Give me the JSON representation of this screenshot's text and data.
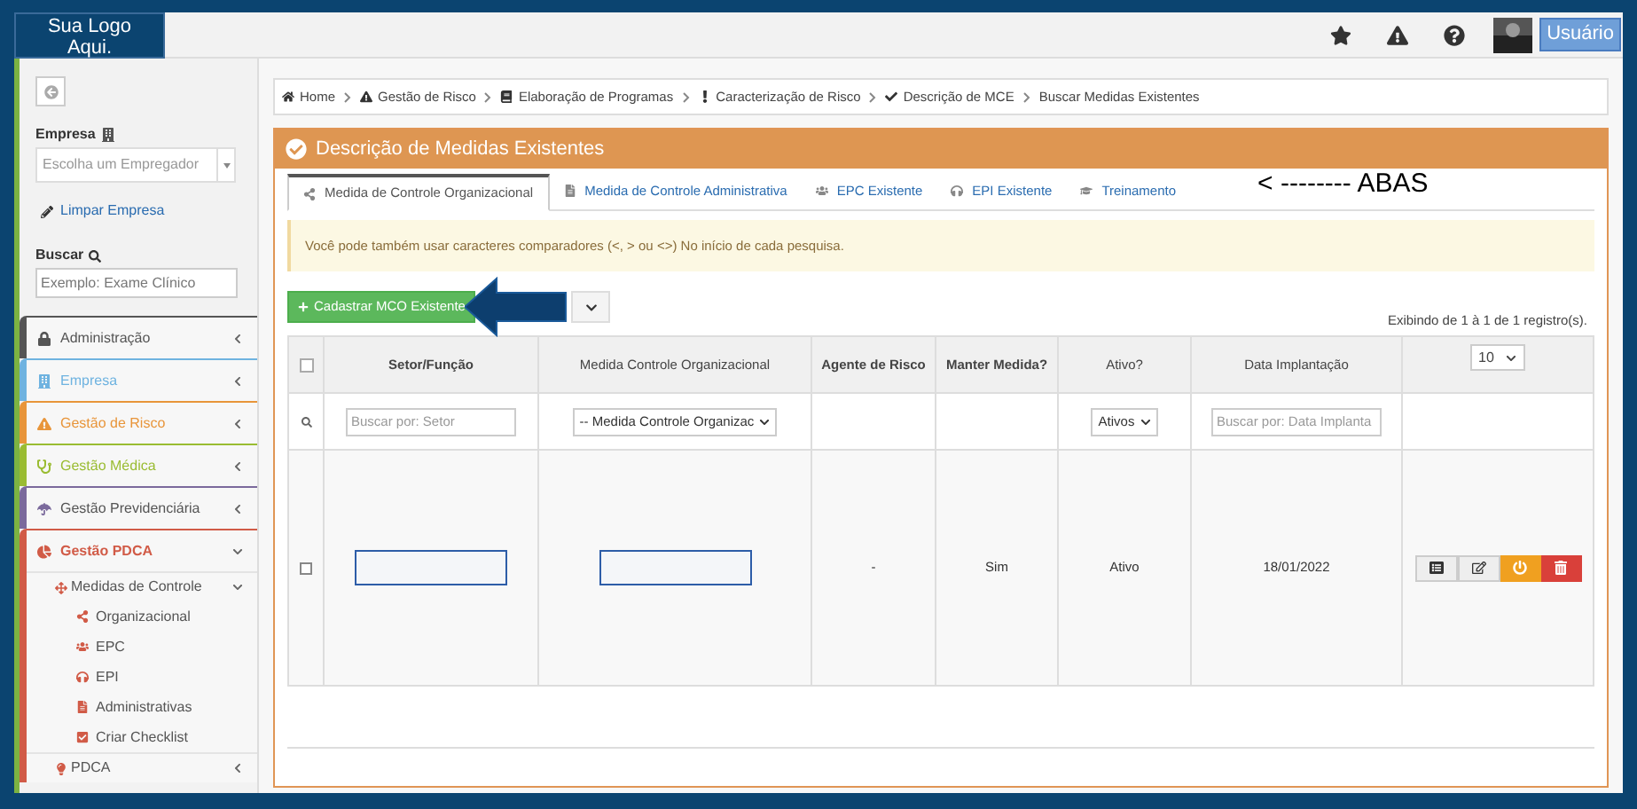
{
  "logo": {
    "text": "Sua Logo Aqui."
  },
  "topbar": {
    "user_button": "Usuário"
  },
  "sidebar": {
    "empresa_label": "Empresa",
    "empresa_select": {
      "placeholder": "Escolha um Empregador"
    },
    "clear_link": "Limpar Empresa",
    "search_label": "Buscar",
    "search": {
      "placeholder": "Exemplo: Exame Clínico"
    },
    "menu": [
      {
        "label": "Administração",
        "kind": "lock",
        "color": "#555555",
        "expanded": false
      },
      {
        "label": "Empresa",
        "kind": "building",
        "color": "#6fb3e0",
        "expanded": false
      },
      {
        "label": "Gestão de Risco",
        "kind": "warning",
        "color": "#e8953a",
        "expanded": false
      },
      {
        "label": "Gestão Médica",
        "kind": "stethoscope",
        "color": "#9abc32",
        "expanded": false
      },
      {
        "label": "Gestão Previdenciária",
        "kind": "umbrella",
        "color": "#7b6a9c",
        "expanded": false
      },
      {
        "label": "Gestão PDCA",
        "kind": "pie",
        "color": "#d15b47",
        "expanded": true,
        "children": [
          {
            "label": "Medidas de Controle",
            "kind": "move",
            "expanded": true,
            "children": [
              {
                "label": "Organizacional",
                "kind": "share"
              },
              {
                "label": "EPC",
                "kind": "users"
              },
              {
                "label": "EPI",
                "kind": "headphones"
              },
              {
                "label": "Administrativas",
                "kind": "file"
              },
              {
                "label": "Criar Checklist",
                "kind": "checkbox"
              }
            ]
          },
          {
            "label": "PDCA",
            "kind": "bulb",
            "expanded": false
          }
        ]
      }
    ]
  },
  "breadcrumb": [
    {
      "label": "Home",
      "kind": "home"
    },
    {
      "label": "Gestão de Risco",
      "kind": "warning"
    },
    {
      "label": "Elaboração de Programas",
      "kind": "book"
    },
    {
      "label": "Caracterização de Risco",
      "kind": "exclamation"
    },
    {
      "label": "Descrição de MCE",
      "kind": "check"
    },
    {
      "label": "Buscar Medidas Existentes",
      "kind": "none"
    }
  ],
  "panel": {
    "title": "Descrição de Medidas Existentes",
    "tabs": [
      {
        "label": "Medida de Controle Organizacional",
        "kind": "share",
        "selected": true
      },
      {
        "label": "Medida de Controle Administrativa",
        "kind": "file",
        "selected": false
      },
      {
        "label": "EPC Existente",
        "kind": "users",
        "selected": false
      },
      {
        "label": "EPI Existente",
        "kind": "headphones",
        "selected": false
      },
      {
        "label": "Treinamento",
        "kind": "cap",
        "selected": false
      }
    ],
    "annotation": "< -------- ABAS",
    "alert": "Você pode também usar caracteres comparadores (<, > ou <>) No início de cada pesquisa.",
    "add_button": "Cadastrar MCO Existente",
    "count": "Exibindo de 1 à 1 de 1 registro(s).",
    "page_size": "10",
    "table": {
      "columns": [
        {
          "label": "Setor/Função",
          "bold": true
        },
        {
          "label": "Medida Controle Organizacional",
          "bold": false
        },
        {
          "label": "Agente de Risco",
          "bold": true
        },
        {
          "label": "Manter Medida?",
          "bold": true
        },
        {
          "label": "Ativo?",
          "bold": false
        },
        {
          "label": "Data Implantação",
          "bold": false
        }
      ],
      "header_checked": false,
      "filters": [
        {
          "kind": "input",
          "placeholder": "Buscar por: Setor"
        },
        {
          "kind": "select",
          "value": "-- Medida Controle Organizac"
        },
        {
          "kind": "empty"
        },
        {
          "kind": "empty"
        },
        {
          "kind": "select",
          "value": "Ativos"
        },
        {
          "kind": "input",
          "placeholder": "Buscar por: Data Implanta"
        }
      ],
      "rows": [
        {
          "checked": false,
          "cells": [
            {
              "kind": "redacted"
            },
            {
              "kind": "redacted"
            },
            {
              "kind": "text",
              "text": "-"
            },
            {
              "kind": "text",
              "text": "Sim"
            },
            {
              "kind": "text",
              "text": "Ativo"
            },
            {
              "kind": "text",
              "text": "18/01/2022"
            }
          ]
        }
      ]
    }
  }
}
